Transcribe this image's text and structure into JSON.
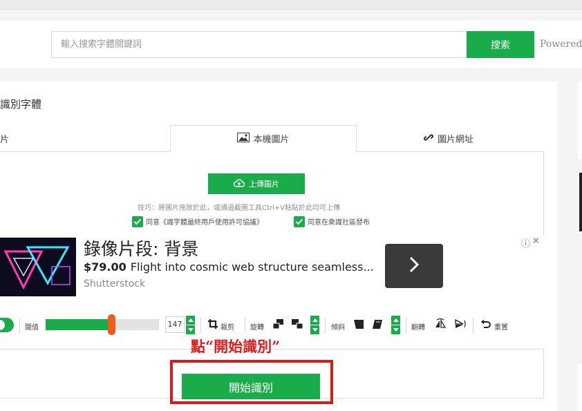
{
  "search": {
    "placeholder": "輸入搜索字體關鍵詞",
    "button_label": "搜索",
    "powered_by": "Powered by"
  },
  "section": {
    "title": "在線識別字體"
  },
  "tabs": [
    {
      "label": "圖片"
    },
    {
      "label": "本機圖片",
      "icon": "image-icon"
    },
    {
      "label": "圖片網址",
      "icon": "link-icon"
    }
  ],
  "upload": {
    "button_label": "上傳圖片",
    "tip": "技巧：將圖片拖放於此，或通過截圖工具Ctrl+V粘貼於此均可上傳",
    "agree_license": "同意《識字體最終用戶使用許可協議》",
    "agree_community": "同意在衆識社區發布"
  },
  "ad": {
    "title": "錄像片段: 背景",
    "price": "$79.00",
    "description": "Flight into cosmic web structure seamless...",
    "brand": "Shutterstock",
    "info_glyph": "ⓘ",
    "close_glyph": "✕"
  },
  "toolbar": {
    "threshold_label": "閾值",
    "threshold_value": "147",
    "threshold_level": 0.58,
    "crop_label": "裁剪",
    "rotate_label": "旋轉",
    "skew_label": "傾斜",
    "flip_label": "翻轉",
    "reset_label": "重置"
  },
  "annotation": "點“開始識別”",
  "start_button_label": "開始識別",
  "colors": {
    "accent": "#1aab4b",
    "slider_handle": "#f05a1a",
    "annotation": "#e01b1b"
  }
}
